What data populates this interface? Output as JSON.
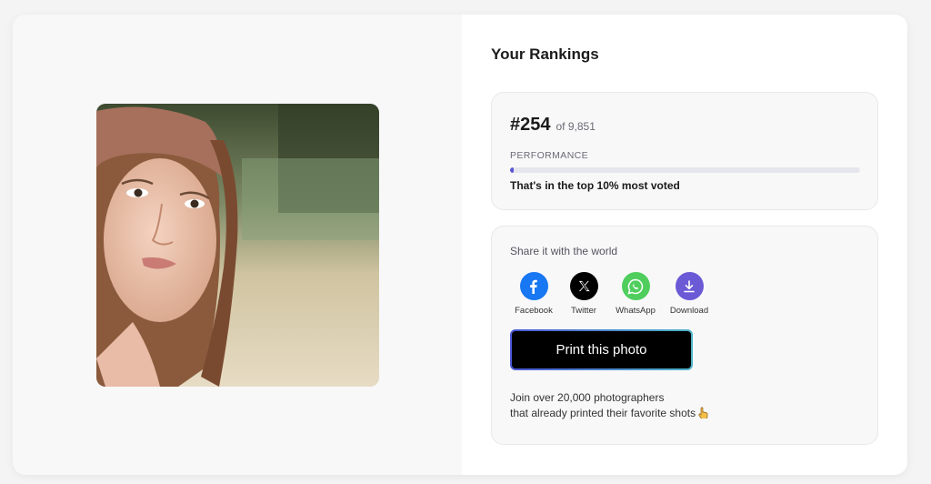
{
  "rankings": {
    "title": "Your Rankings",
    "rank": "#254",
    "of_total": "of 9,851",
    "performance_label": "PERFORMANCE",
    "performance_fraction": 0.01,
    "performance_text": "That's in the top 10% most voted"
  },
  "share": {
    "label": "Share it with the world",
    "buttons": [
      {
        "label": "Facebook",
        "icon": "facebook-icon",
        "color": "#1877f2"
      },
      {
        "label": "Twitter",
        "icon": "x-twitter-icon",
        "color": "#000000"
      },
      {
        "label": "WhatsApp",
        "icon": "whatsapp-icon",
        "color": "#4fce5d"
      },
      {
        "label": "Download",
        "icon": "download-icon",
        "color": "#6b5ad6"
      }
    ],
    "print_button": "Print this photo",
    "join_line1": "Join over 20,000 photographers",
    "join_line2": "that already printed their favorite shots",
    "join_emoji_icon": "pointing-hand-icon"
  },
  "colors": {
    "accent": "#5a56d6",
    "gradient_start": "#4b57d6",
    "gradient_end": "#4fb3c6"
  }
}
